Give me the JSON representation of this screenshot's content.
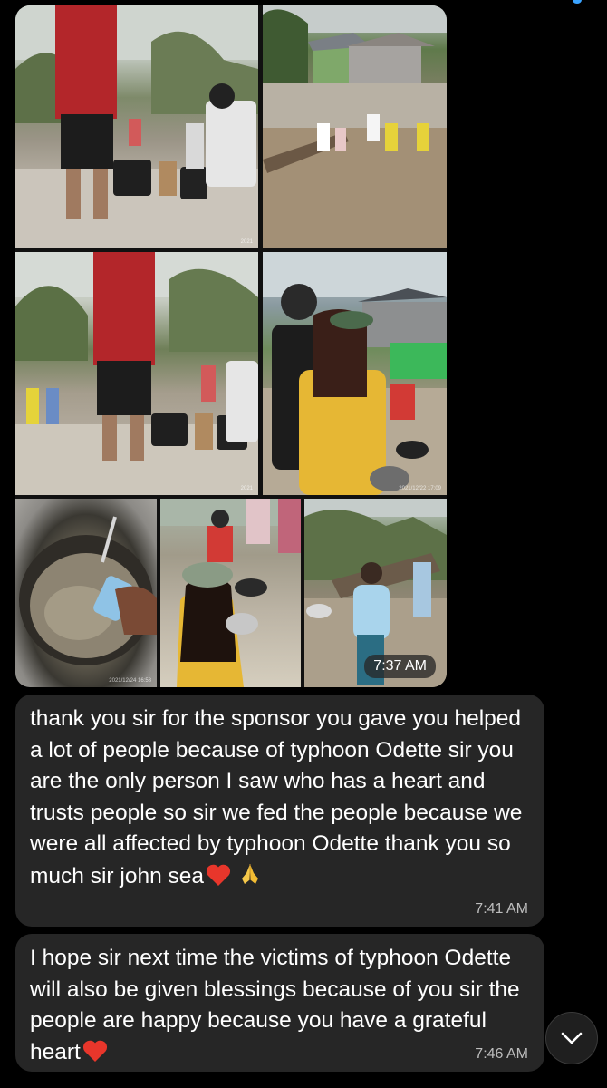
{
  "photos_time": "7:37 AM",
  "photo_stamps": [
    "2021",
    "",
    "2021",
    "2021/12/22 17:09",
    "2021/12/24 16:58"
  ],
  "messages": [
    {
      "text": "thank you sir for the sponsor you gave you helped a lot of people because of typhoon Odette sir you are the only person I saw who has a heart and trusts people so sir we fed the people because we were all affected by typhoon Odette thank you so much sir john sea",
      "emojis": [
        "red-heart",
        "folded-hands"
      ],
      "time": "7:41 AM"
    },
    {
      "text": "I hope sir next time the victims of typhoon Odette will also be given blessings because of you sir the people are happy because you have a grateful heart",
      "emojis": [
        "red-heart"
      ],
      "time": "7:46 AM"
    }
  ],
  "colors": {
    "background": "#000000",
    "bubble": "#262626",
    "text": "#ffffff",
    "timestamp": "#bdbdbd",
    "heart": "#e8362b"
  },
  "icons": {
    "scroll_down": "chevron-down-icon"
  }
}
